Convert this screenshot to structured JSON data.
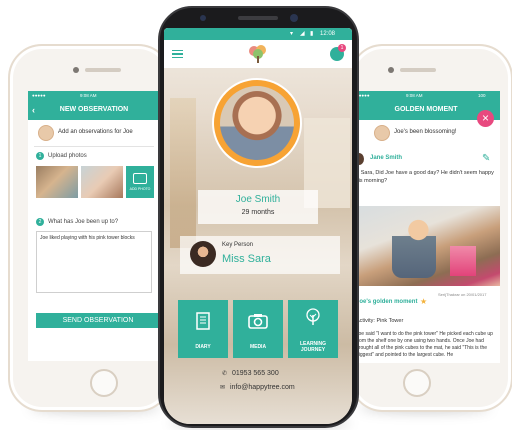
{
  "left_phone": {
    "status": {
      "carrier": "●●●●● ⁠",
      "time": "9:08 AM",
      "battery": "100%"
    },
    "title": "NEW OBSERVATION",
    "subject_prompt": "Add an observations for Joe",
    "step1": {
      "number": "1",
      "label": "Upload photos"
    },
    "add_photo_label": "ADD PHOTO",
    "step2": {
      "number": "2",
      "label": "What has Joe been up to?"
    },
    "observation_text": "Joe liked playing with his pink tower blocks",
    "send_label": "SEND OBSERVATION"
  },
  "center_phone": {
    "status_time": "12:08",
    "notification_count": "1",
    "child_name": "Joe Smith",
    "child_age": "29 months",
    "key_person_label": "Key Person",
    "key_person_name": "Miss Sara",
    "tiles": [
      {
        "label": "DIARY",
        "icon": "diary-icon"
      },
      {
        "label": "MEDIA",
        "icon": "camera-icon"
      },
      {
        "label": "LEARNING JOURNEY",
        "icon": "tree-icon"
      }
    ],
    "phone": "01953 565 300",
    "email": "info@happytree.com"
  },
  "right_phone": {
    "status": {
      "carrier": "●●●●● ⁠",
      "time": "9:08 AM",
      "battery": "100"
    },
    "title": "GOLDEN MOMENT",
    "headline": "Joe's been blossoming!",
    "author": "Jane Smith",
    "message": "Hi Sara, Did Joe have a good day? He didn't seem happy this morning?",
    "moment_title": "Joe's golden moment",
    "credit": "SerijThakrar on 20/01/2017",
    "activity": "Activity: Pink Tower",
    "body": "Joe said \"I want to do the pink tower\" He picked each cube up from the shelf one by one using two hands. Once Joe had brought all of the pink cubes to the mat, he said \"This is the biggest\" and pointed to the largest cube. He"
  },
  "colors": {
    "teal": "#30b09b",
    "pink": "#e8497f",
    "dark_phone": "#1b1b1d"
  }
}
